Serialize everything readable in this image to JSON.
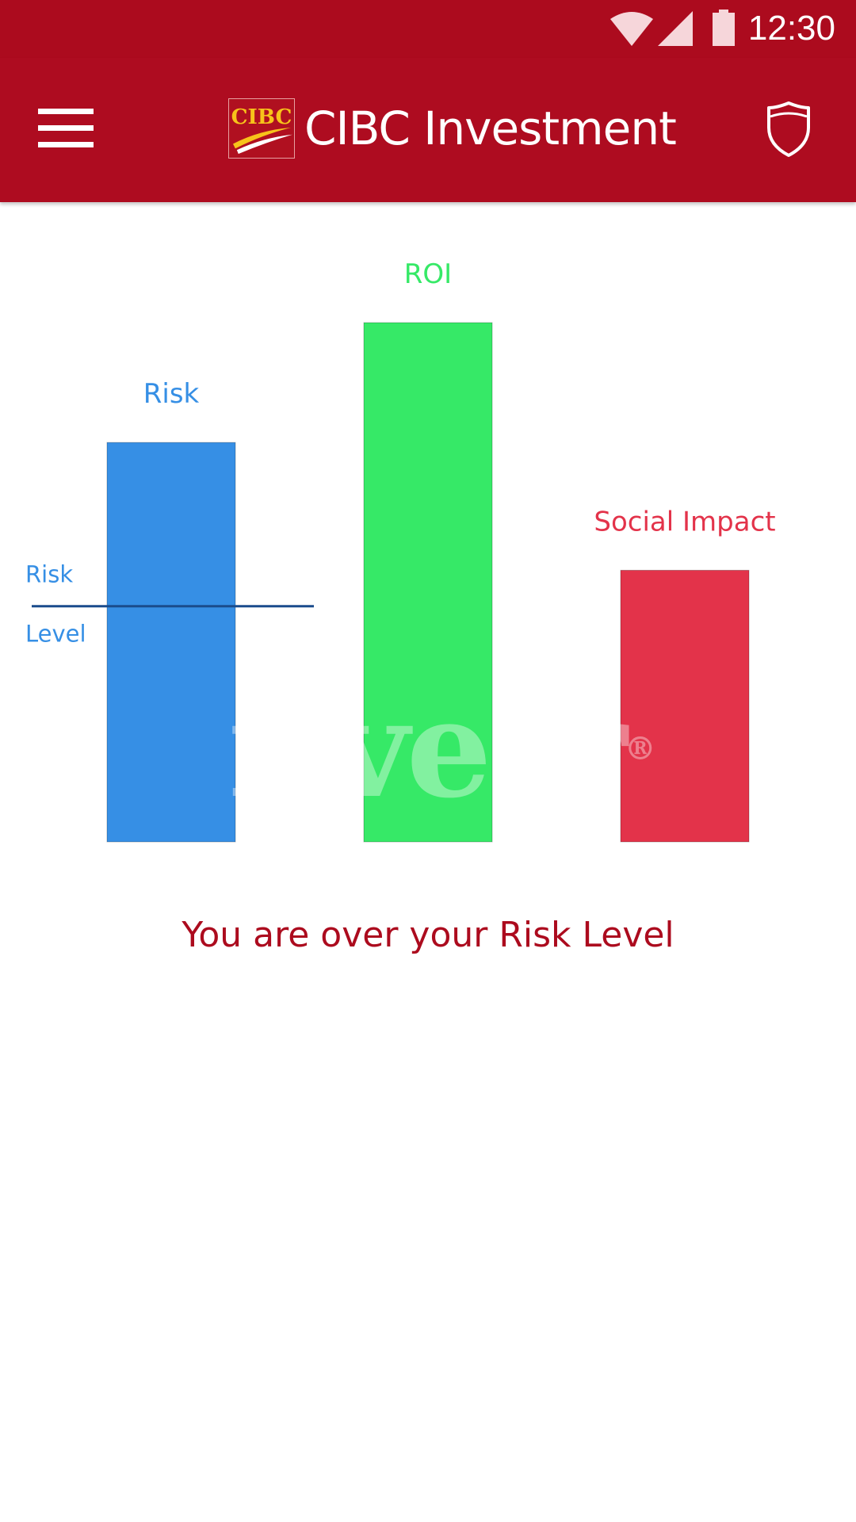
{
  "status_bar": {
    "time": "12:30",
    "icons": [
      "wifi-icon",
      "cellular-signal-icon",
      "battery-icon"
    ]
  },
  "app_bar": {
    "menu_icon": "hamburger-menu-icon",
    "logo_text": "CIBC",
    "title": "CIBC Investment",
    "action_icon": "shield-icon"
  },
  "colors": {
    "primary": "#ac0b1e",
    "risk": "#368fe5",
    "roi": "#36e967",
    "social_impact": "#e3334a",
    "risk_level_line": "#1a4c8c"
  },
  "chart_data": {
    "type": "bar",
    "categories": [
      "Risk",
      "ROI",
      "Social Impact"
    ],
    "values": [
      100,
      130,
      68
    ],
    "colors": [
      "#368fe5",
      "#36e967",
      "#e3334a"
    ],
    "ylim": [
      0,
      130
    ],
    "grid": false,
    "legend": "none",
    "reference_line": {
      "label_top": "Risk",
      "label_bottom": "Level",
      "value": 59,
      "color": "#1a4c8c"
    }
  },
  "watermark": {
    "text": "fiverr",
    "mark": "®"
  },
  "message": "You are over your Risk Level"
}
